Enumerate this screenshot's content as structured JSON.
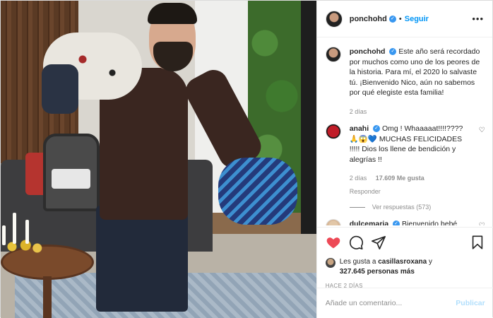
{
  "header": {
    "username": "ponchohd",
    "separator": "•",
    "follow_label": "Seguir",
    "more_label": "•••"
  },
  "caption": {
    "username": "ponchohd",
    "text": "Este año será recordado por muchos como uno de los peores de la historia. Para mí, el 2020 lo salvaste tú. ¡Bienvenido Nico, aún no sabemos por qué elegiste esta familia!",
    "time": "2 días"
  },
  "comments": [
    {
      "username": "anahi",
      "text": "Omg ! Whaaaaat!!!!???? 🙏😱💙 MUCHAS FELICIDADES !!!!! Dios los llene de bendición y alegrías !!",
      "time": "2 días",
      "likes": "17.609 Me gusta",
      "reply": "Responder",
      "view_replies": "Ver respuestas (573)"
    },
    {
      "username": "dulcemaria",
      "text": "Bienvenido bebé"
    }
  ],
  "actions": {
    "liked_by_prefix": "Les gusta a",
    "liked_by_user": "casillasroxana",
    "liked_by_and": "y",
    "liked_by_count": "327.645 personas más",
    "time": "HACE 2 DÍAS"
  },
  "composer": {
    "placeholder": "Añade un comentario...",
    "publish_label": "Publicar"
  },
  "colors": {
    "accent": "#0095f6",
    "liked_heart": "#ed4956",
    "publish_disabled": "#b2dffc",
    "verified": "#3897f0"
  }
}
